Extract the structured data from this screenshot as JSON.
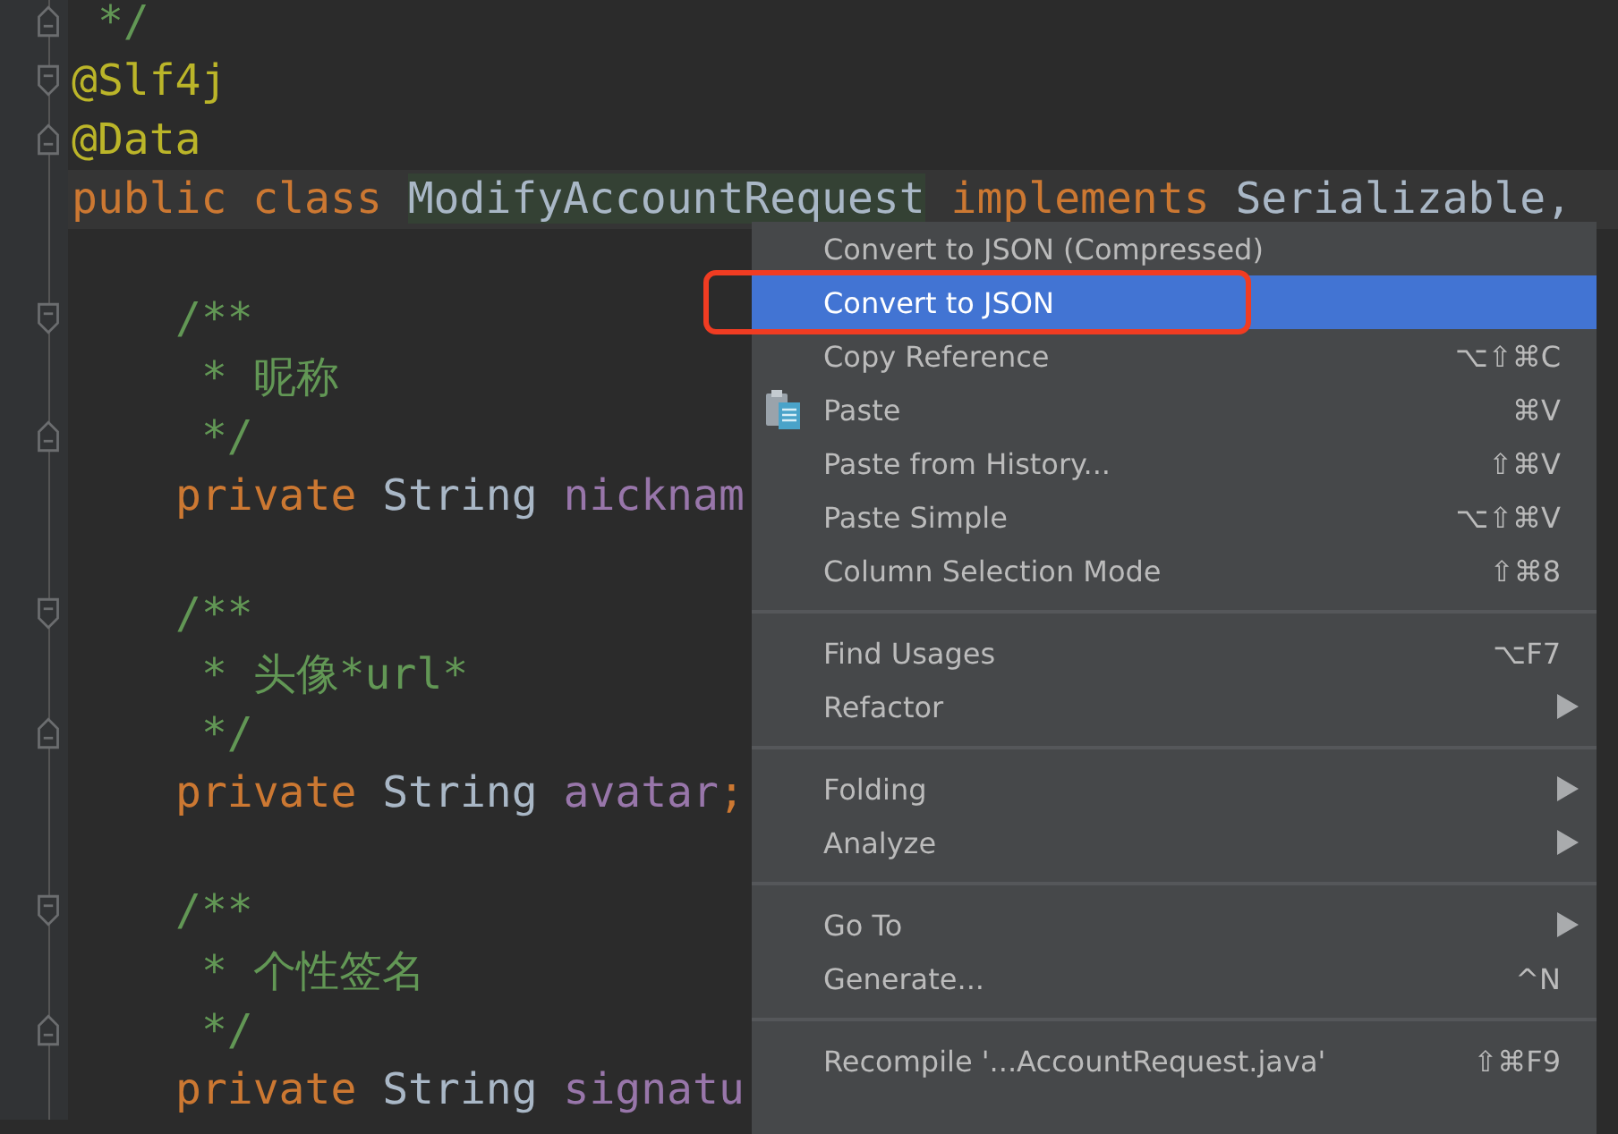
{
  "editor": {
    "lines": [
      {
        "kind": "plain",
        "fold_start": false,
        "fold_end": true,
        "tokens": [
          {
            "kind": "comment",
            "text": " */"
          }
        ]
      },
      {
        "kind": "plain",
        "fold_start": true,
        "fold_end": false,
        "tokens": [
          {
            "kind": "annotation",
            "text": "@Slf4j"
          }
        ]
      },
      {
        "kind": "plain",
        "fold_start": false,
        "fold_end": true,
        "tokens": [
          {
            "kind": "annotation",
            "text": "@Data"
          }
        ]
      },
      {
        "kind": "current",
        "fold_start": false,
        "fold_end": false,
        "tokens": [
          {
            "kind": "keyword",
            "text": "public class "
          },
          {
            "kind": "declaration",
            "text": "ModifyAccountRequest"
          },
          {
            "kind": "keyword",
            "text": " implements "
          },
          {
            "kind": "type",
            "text": "Serializable,"
          }
        ]
      },
      {
        "kind": "blank",
        "fold_start": false,
        "fold_end": false
      },
      {
        "kind": "member",
        "fold_start": true,
        "fold_end": false,
        "tokens": [
          {
            "kind": "comment",
            "text": "/**"
          }
        ]
      },
      {
        "kind": "member",
        "fold_start": false,
        "fold_end": false,
        "tokens": [
          {
            "kind": "comment",
            "text": " * 昵称"
          }
        ]
      },
      {
        "kind": "member",
        "fold_start": false,
        "fold_end": true,
        "tokens": [
          {
            "kind": "comment",
            "text": " */"
          }
        ]
      },
      {
        "kind": "member",
        "fold_start": false,
        "fold_end": false,
        "tokens": [
          {
            "kind": "keyword",
            "text": "private "
          },
          {
            "kind": "type",
            "text": "String "
          },
          {
            "kind": "field",
            "text": "nicknam"
          }
        ]
      },
      {
        "kind": "blank",
        "fold_start": false,
        "fold_end": false
      },
      {
        "kind": "member",
        "fold_start": true,
        "fold_end": false,
        "tokens": [
          {
            "kind": "comment",
            "text": "/**"
          }
        ]
      },
      {
        "kind": "member",
        "fold_start": false,
        "fold_end": false,
        "tokens": [
          {
            "kind": "comment",
            "text": " * 头像*url*"
          }
        ]
      },
      {
        "kind": "member",
        "fold_start": false,
        "fold_end": true,
        "tokens": [
          {
            "kind": "comment",
            "text": " */"
          }
        ]
      },
      {
        "kind": "member",
        "fold_start": false,
        "fold_end": false,
        "tokens": [
          {
            "kind": "keyword",
            "text": "private "
          },
          {
            "kind": "type",
            "text": "String "
          },
          {
            "kind": "field",
            "text": "avatar"
          },
          {
            "kind": "keyword",
            "text": ";"
          }
        ]
      },
      {
        "kind": "blank",
        "fold_start": false,
        "fold_end": false
      },
      {
        "kind": "member",
        "fold_start": true,
        "fold_end": false,
        "tokens": [
          {
            "kind": "comment",
            "text": "/**"
          }
        ]
      },
      {
        "kind": "member",
        "fold_start": false,
        "fold_end": false,
        "tokens": [
          {
            "kind": "comment",
            "text": " * 个性签名"
          }
        ]
      },
      {
        "kind": "member",
        "fold_start": false,
        "fold_end": true,
        "tokens": [
          {
            "kind": "comment",
            "text": " */"
          }
        ]
      },
      {
        "kind": "member",
        "fold_start": false,
        "fold_end": false,
        "tokens": [
          {
            "kind": "keyword",
            "text": "private "
          },
          {
            "kind": "type",
            "text": "String "
          },
          {
            "kind": "field",
            "text": "signatu"
          }
        ]
      }
    ]
  },
  "context_menu": {
    "groups": [
      [
        {
          "kind": "action",
          "label": "Convert to JSON (Compressed)",
          "selected": false,
          "callout": false
        },
        {
          "kind": "action",
          "label": "Convert to JSON",
          "selected": true,
          "callout": true
        },
        {
          "kind": "action",
          "label": "Copy Reference",
          "shortcut": "⌥⇧⌘C",
          "selected": false,
          "callout": false
        },
        {
          "kind": "paste",
          "label": "Paste",
          "shortcut": "⌘V",
          "selected": false,
          "callout": false
        },
        {
          "kind": "action",
          "label": "Paste from History...",
          "shortcut": "⇧⌘V",
          "selected": false,
          "callout": false
        },
        {
          "kind": "action",
          "label": "Paste Simple",
          "shortcut": "⌥⇧⌘V",
          "selected": false,
          "callout": false
        },
        {
          "kind": "action",
          "label": "Column Selection Mode",
          "shortcut": "⇧⌘8",
          "selected": false,
          "callout": false
        }
      ],
      [
        {
          "kind": "action",
          "label": "Find Usages",
          "shortcut": "⌥F7",
          "selected": false,
          "callout": false
        },
        {
          "kind": "submenu",
          "label": "Refactor",
          "selected": false,
          "callout": false
        }
      ],
      [
        {
          "kind": "submenu",
          "label": "Folding",
          "selected": false,
          "callout": false
        },
        {
          "kind": "submenu",
          "label": "Analyze",
          "selected": false,
          "callout": false
        }
      ],
      [
        {
          "kind": "submenu",
          "label": "Go To",
          "selected": false,
          "callout": false
        },
        {
          "kind": "action",
          "label": "Generate...",
          "shortcut": "^N",
          "selected": false,
          "callout": false
        }
      ],
      [
        {
          "kind": "action",
          "label": "Recompile '...AccountRequest.java'",
          "shortcut": "⇧⌘F9",
          "selected": false,
          "callout": false
        }
      ]
    ]
  }
}
